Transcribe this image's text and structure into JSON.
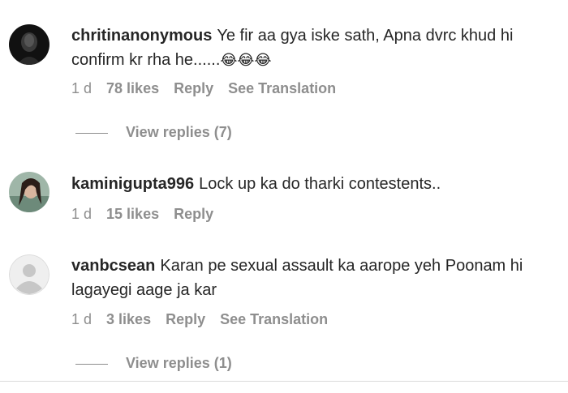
{
  "comments": [
    {
      "username": "chritinanonymous",
      "text": "Ye fir aa gya iske sath, Apna dvrc khud hi confirm kr rha he......",
      "emoji": "😂😂😂",
      "time": "1 d",
      "likes": "78 likes",
      "reply_label": "Reply",
      "translation_label": "See Translation",
      "view_replies": "View replies (7)"
    },
    {
      "username": "kaminigupta996",
      "text": "Lock up ka do tharki contestents..",
      "time": "1 d",
      "likes": "15 likes",
      "reply_label": "Reply"
    },
    {
      "username": "vanbcsean",
      "text": "Karan pe sexual assault ka aarope yeh Poonam hi lagayegi aage ja kar",
      "time": "1 d",
      "likes": "3 likes",
      "reply_label": "Reply",
      "translation_label": "See Translation",
      "view_replies": "View replies (1)"
    }
  ]
}
